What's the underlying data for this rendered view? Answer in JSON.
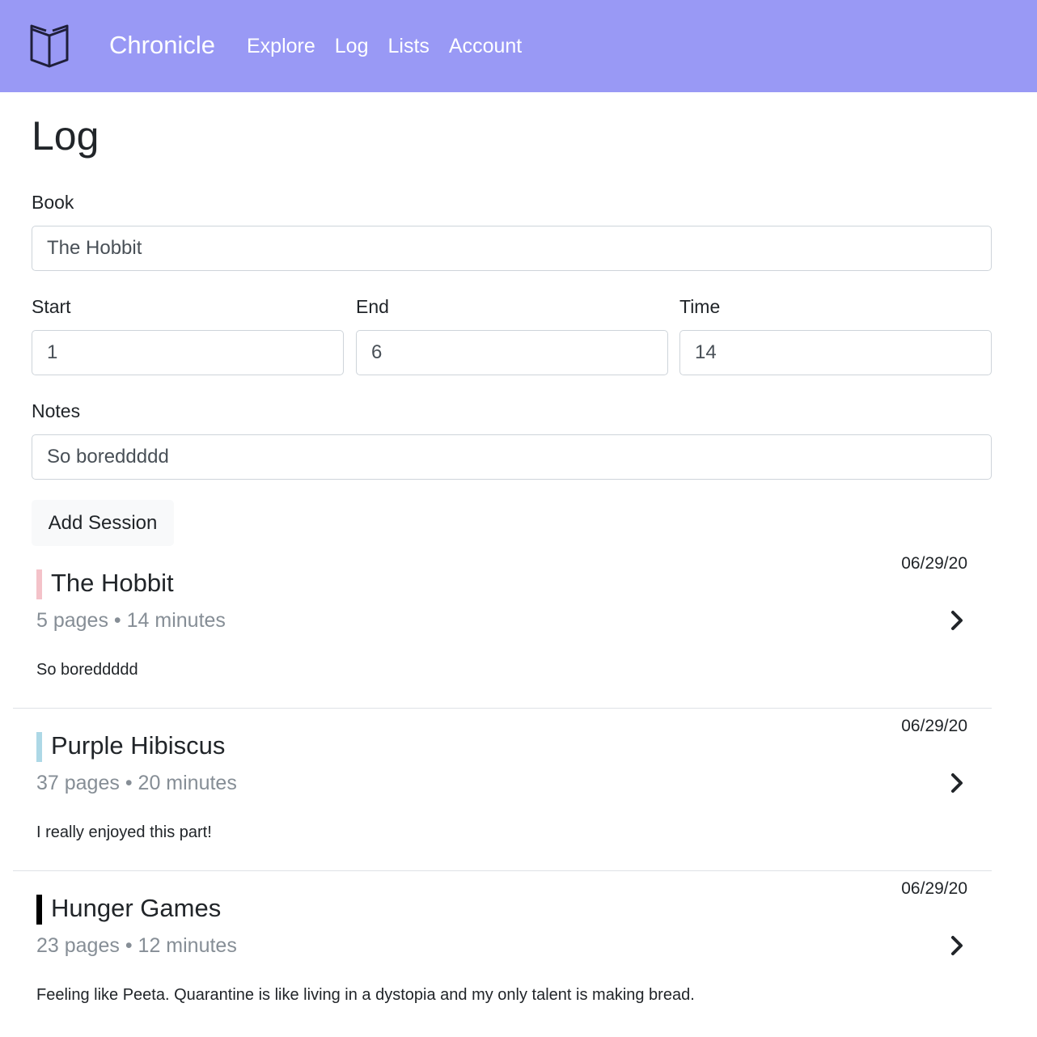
{
  "header": {
    "brand": "Chronicle",
    "logo_icon": "book-icon",
    "background": "#9999f5",
    "nav": [
      {
        "label": "Explore"
      },
      {
        "label": "Log"
      },
      {
        "label": "Lists"
      },
      {
        "label": "Account"
      }
    ]
  },
  "page": {
    "title": "Log"
  },
  "form": {
    "book_label": "Book",
    "book_value": "The Hobbit",
    "start_label": "Start",
    "start_value": "1",
    "end_label": "End",
    "end_value": "6",
    "time_label": "Time",
    "time_value": "14",
    "notes_label": "Notes",
    "notes_value": "So boreddddd",
    "submit_label": "Add Session"
  },
  "sessions": [
    {
      "title": "The Hobbit",
      "pages": "5 pages",
      "separator": "•",
      "minutes": "14 minutes",
      "date": "06/29/20",
      "note": "So boreddddd",
      "color": "#f4c2c9"
    },
    {
      "title": "Purple Hibiscus",
      "pages": "37 pages",
      "separator": "•",
      "minutes": "20 minutes",
      "date": "06/29/20",
      "note": "I really enjoyed this part!",
      "color": "#add8e6"
    },
    {
      "title": "Hunger Games",
      "pages": "23 pages",
      "separator": "•",
      "minutes": "12 minutes",
      "date": "06/29/20",
      "note": "Feeling like Peeta. Quarantine is like living in a dystopia and my only talent is making bread.",
      "color": "#000000"
    }
  ]
}
